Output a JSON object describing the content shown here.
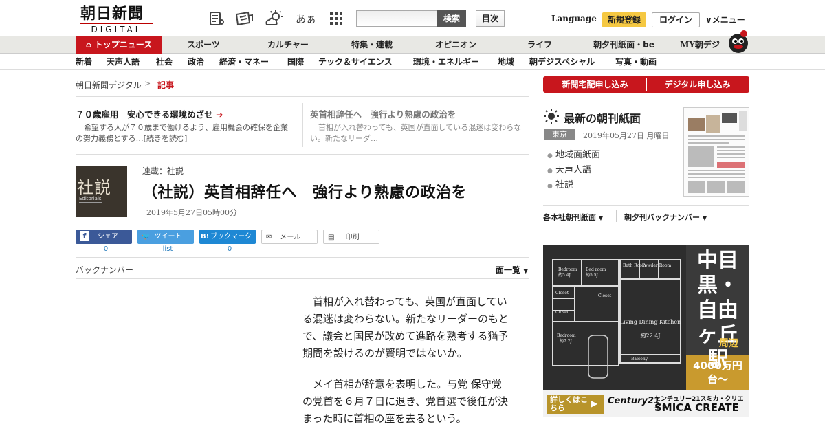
{
  "header": {
    "logo_line1": "朝日新聞",
    "logo_line2": "DIGITAL",
    "icons": [
      "news-icon",
      "newspaper-icon",
      "weather-icon",
      "font-size-icon",
      "apps-icon"
    ],
    "font_icon_text": "あぁ",
    "search": {
      "placeholder": "",
      "button": "検索"
    },
    "toc": "目次",
    "language": "Language",
    "register": "新規登録",
    "login": "ログイン",
    "menu": "メニュー"
  },
  "nav1": [
    {
      "label": "トップニュース"
    },
    {
      "label": "スポーツ"
    },
    {
      "label": "カルチャー"
    },
    {
      "label": "特集・連載"
    },
    {
      "label": "オピニオン"
    },
    {
      "label": "ライフ"
    },
    {
      "label": "朝夕刊紙面・be"
    },
    {
      "label": "MY朝デジ"
    }
  ],
  "nav2": [
    "新着",
    "天声人語",
    "社会",
    "政治",
    "経済・マネー",
    "国際",
    "テック＆サイエンス",
    "環境・エネルギー",
    "地域",
    "朝デジスペシャル",
    "写真・動画"
  ],
  "breadcrumb": {
    "home": "朝日新聞デジタル",
    "sep": ">",
    "current": "記事"
  },
  "related": [
    {
      "title": "７０歳雇用　安心できる環境めざせ",
      "text": "希望する人が７０歳まで働けるよう、雇用機会の確保を企業の努力義務とする…[続きを読む]"
    },
    {
      "title": "英首相辞任へ　強行より熟慮の政治を",
      "text": "首相が入れ替わっても、英国が直面している混迷は変わらない。新たなリーダ…"
    }
  ],
  "article": {
    "thumb_big": "社説",
    "thumb_small": "Editorials",
    "series": "連載：社説",
    "headline": "（社説）英首相辞任へ　強行より熟慮の政治を",
    "date": "2019年5月27日05時00分",
    "paragraphs": [
      "首相が入れ替わっても、英国が直面している混迷は変わらない。新たなリーダーのもとで、議会と国民が改めて進路を熟考する猶予期間を設けるのが賢明ではないか。",
      "メイ首相が辞意を表明した。与党 保守党 の党首を６月７日に退き、党首選で後任が決まった時に首相の座を去るという。"
    ]
  },
  "share": [
    {
      "label": "シェア",
      "count": "0",
      "color": "#3b5998"
    },
    {
      "label": "ツイート",
      "count": "list",
      "color": "#4a9fe0"
    },
    {
      "label": "ブックマーク",
      "count": "0",
      "color": "#1e88d4"
    },
    {
      "label": "メール",
      "count": ""
    },
    {
      "label": "印刷",
      "count": ""
    }
  ],
  "backnumber": {
    "label": "バックナンバー",
    "list": "面一覧"
  },
  "sidebar": {
    "subscribe_paper": "新聞宅配申し込み",
    "subscribe_digital": "デジタル申し込み",
    "morning_title": "最新の朝刊紙面",
    "region": "東京",
    "paper_date": "2019年05月27日 月曜日",
    "links": [
      "地域面紙面",
      "天声人語",
      "社説"
    ],
    "dropdown1": "各本社朝刊紙面",
    "dropdown2": "朝夕刊バックナンバー"
  },
  "ad": {
    "rooms": [
      "Bedroom",
      "Bed room",
      "Closet",
      "Closet",
      "Closet",
      "Bedroom",
      "Bath Room",
      "Powder Room",
      "Living Dining Kitchen",
      "Balcony"
    ],
    "area_labels": [
      "約5.4J",
      "約5.5J",
      "約7.2J",
      "約22.4J"
    ],
    "headline": "中目黒・自由ヶ丘駅",
    "suffix": "周辺",
    "price": "4000万円台〜",
    "cta": "詳しくはこちら",
    "brand": "Century21",
    "brand_company_jp": "センチュリー21スミカ・クリエイト",
    "brand_company": "SMICA CREATE"
  }
}
